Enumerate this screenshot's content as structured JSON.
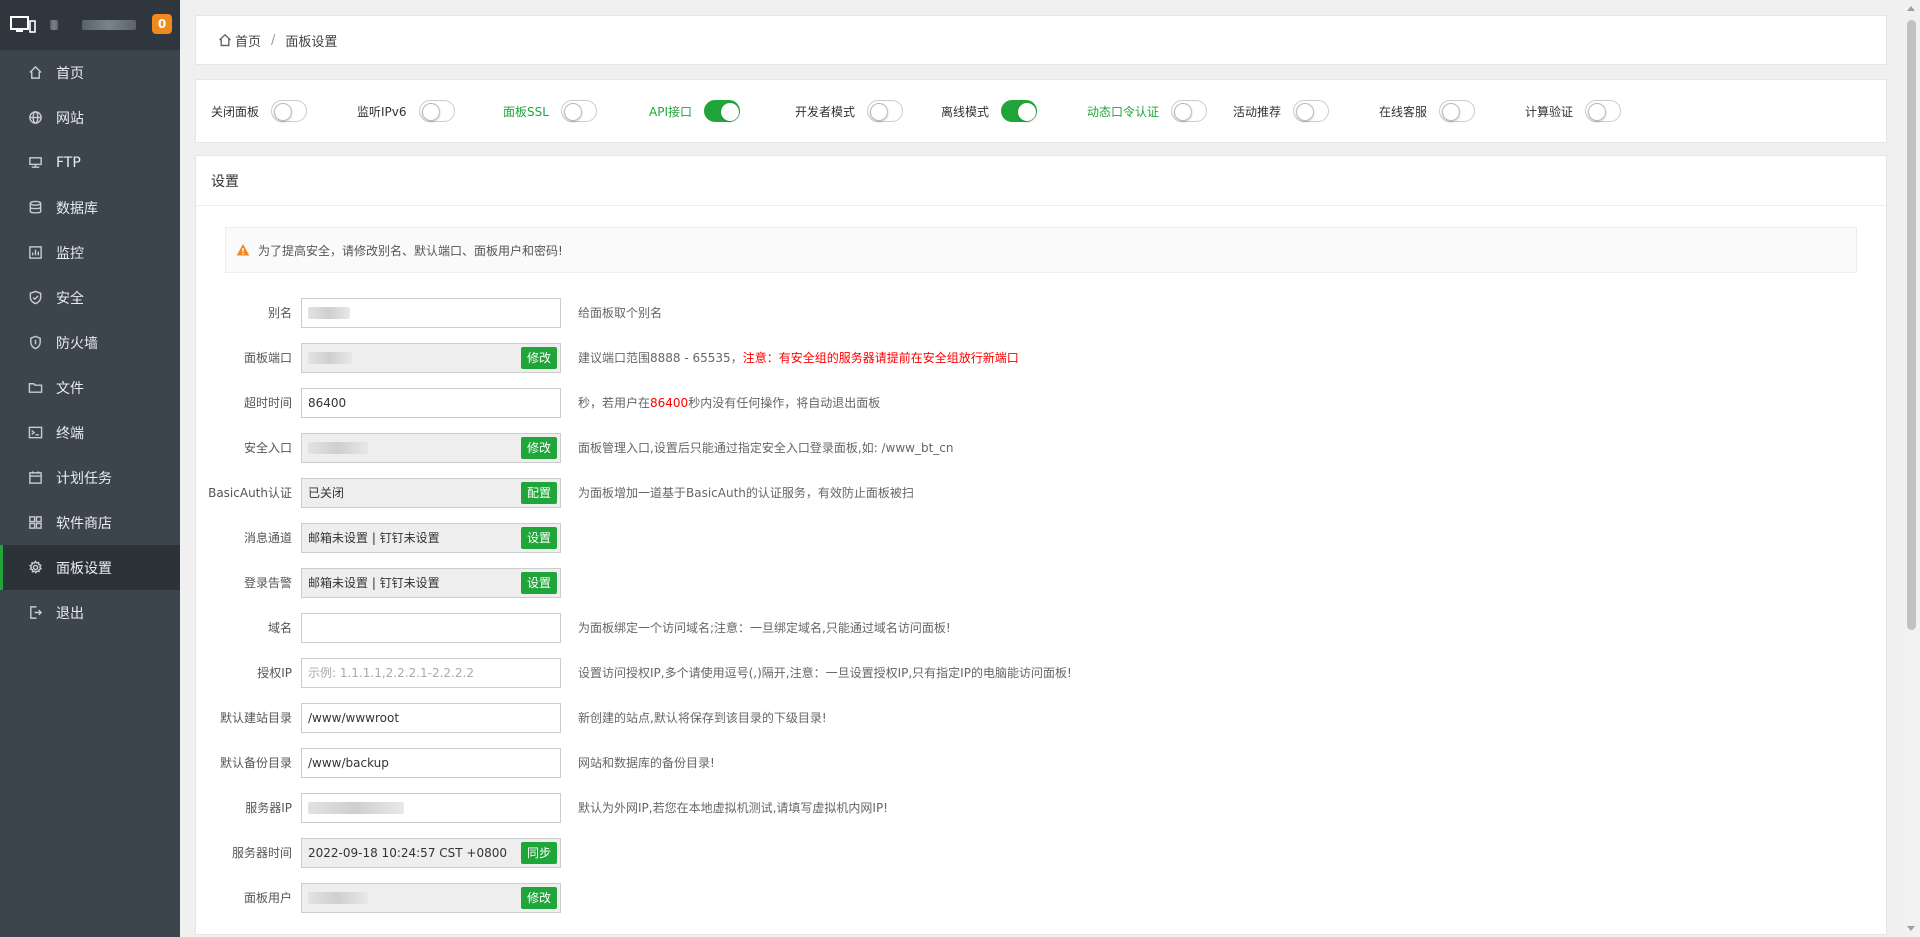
{
  "sidebar": {
    "badge": "0",
    "items": [
      {
        "label": "首页",
        "icon": "home-icon"
      },
      {
        "label": "网站",
        "icon": "globe-icon"
      },
      {
        "label": "FTP",
        "icon": "ftp-icon"
      },
      {
        "label": "数据库",
        "icon": "database-icon"
      },
      {
        "label": "监控",
        "icon": "monitor-icon"
      },
      {
        "label": "安全",
        "icon": "shield-icon"
      },
      {
        "label": "防火墙",
        "icon": "firewall-icon"
      },
      {
        "label": "文件",
        "icon": "folder-icon"
      },
      {
        "label": "终端",
        "icon": "terminal-icon"
      },
      {
        "label": "计划任务",
        "icon": "calendar-icon"
      },
      {
        "label": "软件商店",
        "icon": "apps-icon"
      },
      {
        "label": "面板设置",
        "icon": "gear-icon"
      },
      {
        "label": "退出",
        "icon": "logout-icon"
      }
    ],
    "active_index": 11
  },
  "breadcrumb": {
    "home": "首页",
    "separator": "/",
    "current": "面板设置"
  },
  "toggles": [
    {
      "label": "关闭面板",
      "on": false,
      "green": false
    },
    {
      "label": "监听IPv6",
      "on": false,
      "green": false
    },
    {
      "label": "面板SSL",
      "on": false,
      "green": true
    },
    {
      "label": "API接口",
      "on": true,
      "green": true
    },
    {
      "label": "开发者模式",
      "on": false,
      "green": false
    },
    {
      "label": "离线模式",
      "on": true,
      "green": false
    },
    {
      "label": "动态口令认证",
      "on": false,
      "green": true
    },
    {
      "label": "活动推荐",
      "on": false,
      "green": false
    },
    {
      "label": "在线客服",
      "on": false,
      "green": false
    },
    {
      "label": "计算验证",
      "on": false,
      "green": false
    }
  ],
  "settings": {
    "title": "设置",
    "warning": "为了提高安全，请修改别名、默认端口、面板用户和密码!",
    "rows": {
      "alias": {
        "label": "别名",
        "hint": "给面板取个别名"
      },
      "port": {
        "label": "面板端口",
        "button": "修改",
        "hint": "建议端口范围8888 - 65535，",
        "hint_red": "注意：有安全组的服务器请提前在安全组放行新端口"
      },
      "timeout": {
        "label": "超时时间",
        "value": "86400",
        "hint_pre": "秒，若用户在",
        "hint_red": "86400",
        "hint_post": "秒内没有任何操作，将自动退出面板"
      },
      "entry": {
        "label": "安全入口",
        "button": "修改",
        "hint": "面板管理入口,设置后只能通过指定安全入口登录面板,如: /www_bt_cn"
      },
      "basicauth": {
        "label": "BasicAuth认证",
        "value": "已关闭",
        "button": "配置",
        "hint": "为面板增加一道基于BasicAuth的认证服务，有效防止面板被扫"
      },
      "message": {
        "label": "消息通道",
        "value": "邮箱未设置 | 钉钉未设置",
        "button": "设置"
      },
      "login_alert": {
        "label": "登录告警",
        "value": "邮箱未设置 | 钉钉未设置",
        "button": "设置"
      },
      "domain": {
        "label": "域名",
        "hint": "为面板绑定一个访问域名;注意：一旦绑定域名,只能通过域名访问面板!"
      },
      "auth_ip": {
        "label": "授权IP",
        "placeholder": "示例: 1.1.1.1,2.2.2.1-2.2.2.2",
        "hint": "设置访问授权IP,多个请使用逗号(,)隔开,注意：一旦设置授权IP,只有指定IP的电脑能访问面板!"
      },
      "site_dir": {
        "label": "默认建站目录",
        "value": "/www/wwwroot",
        "hint": "新创建的站点,默认将保存到该目录的下级目录!"
      },
      "backup_dir": {
        "label": "默认备份目录",
        "value": "/www/backup",
        "hint": "网站和数据库的备份目录!"
      },
      "server_ip": {
        "label": "服务器IP",
        "hint": "默认为外网IP,若您在本地虚拟机测试,请填写虚拟机内网IP!"
      },
      "server_time": {
        "label": "服务器时间",
        "value": "2022-09-18 10:24:57 CST +0800",
        "button": "同步"
      },
      "panel_user": {
        "label": "面板用户",
        "button": "修改"
      }
    }
  },
  "colors": {
    "accent": "#20a53a",
    "sidebar_bg": "#3c444d",
    "badge": "#f0891e",
    "warning": "#f0891e",
    "red": "#ff0000"
  }
}
